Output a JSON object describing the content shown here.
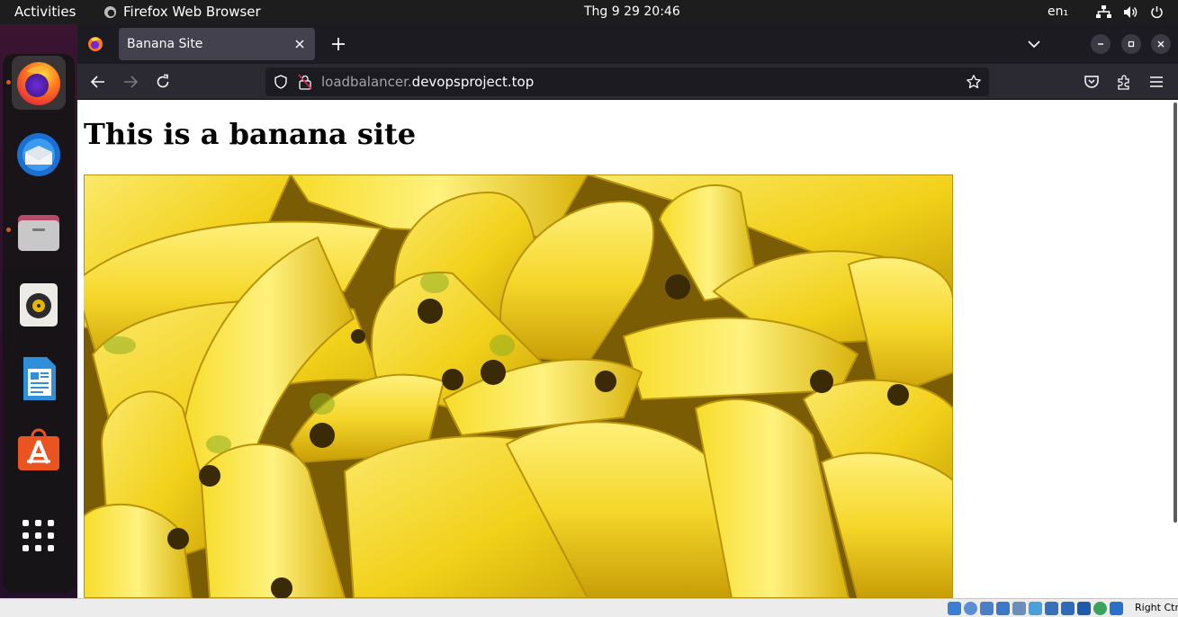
{
  "topbar": {
    "activities": "Activities",
    "app_name": "Firefox Web Browser",
    "clock": "Thg 9 29  20:46",
    "keyboard_layout": "en₁",
    "tray_icons": [
      "network-icon",
      "volume-icon",
      "power-icon"
    ]
  },
  "dock": {
    "items": [
      {
        "name": "Firefox",
        "icon": "firefox-icon",
        "running": true,
        "active": true
      },
      {
        "name": "Thunderbird",
        "icon": "thunderbird-icon",
        "running": false
      },
      {
        "name": "Files",
        "icon": "files-icon",
        "running": true
      },
      {
        "name": "Rhythmbox",
        "icon": "rhythmbox-icon",
        "running": false
      },
      {
        "name": "LibreOffice Writer",
        "icon": "writer-icon",
        "running": false
      },
      {
        "name": "Ubuntu Software",
        "icon": "software-icon",
        "running": false
      },
      {
        "name": "Show Applications",
        "icon": "app-grid-icon",
        "running": false
      }
    ]
  },
  "browser": {
    "tab": {
      "title": "Banana Site"
    },
    "url": {
      "host_prefix": "loadbalancer.",
      "host_domain": "devopsproject.top"
    }
  },
  "page": {
    "heading": "This is a banana site",
    "image": "bananas-photo"
  },
  "vbox_statusbar": {
    "host_key": "Right Ctrl"
  },
  "colors": {
    "topbar": "#1d1d1d",
    "tabstrip": "#1c1b22",
    "toolbar": "#2b2a33",
    "active_tab": "#42414d",
    "running_dot": "#e9541b",
    "banana_yellow": "#f2d11a"
  }
}
